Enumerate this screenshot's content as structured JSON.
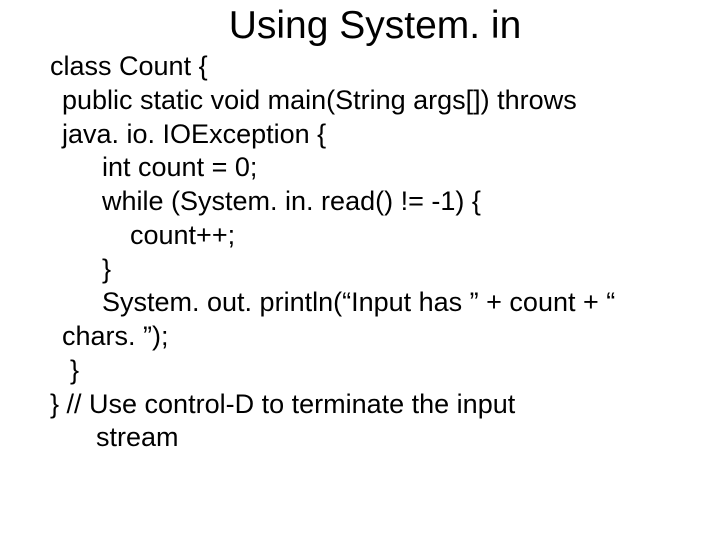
{
  "title": "Using System. in",
  "code": {
    "line1": "class Count {",
    "line2": " public static void main(String args[]) throws",
    "line3": "java. io. IOException  {",
    "line4": "int count = 0;",
    "line5": "while (System. in. read() != -1) {",
    "line6": "count++;",
    "line7": "}",
    "line8": "System. out. println(“Input has ” + count + “",
    "line9": "chars. ”);",
    "line10": "}",
    "line11": "} // Use control-D to terminate the input",
    "line12": "stream"
  }
}
